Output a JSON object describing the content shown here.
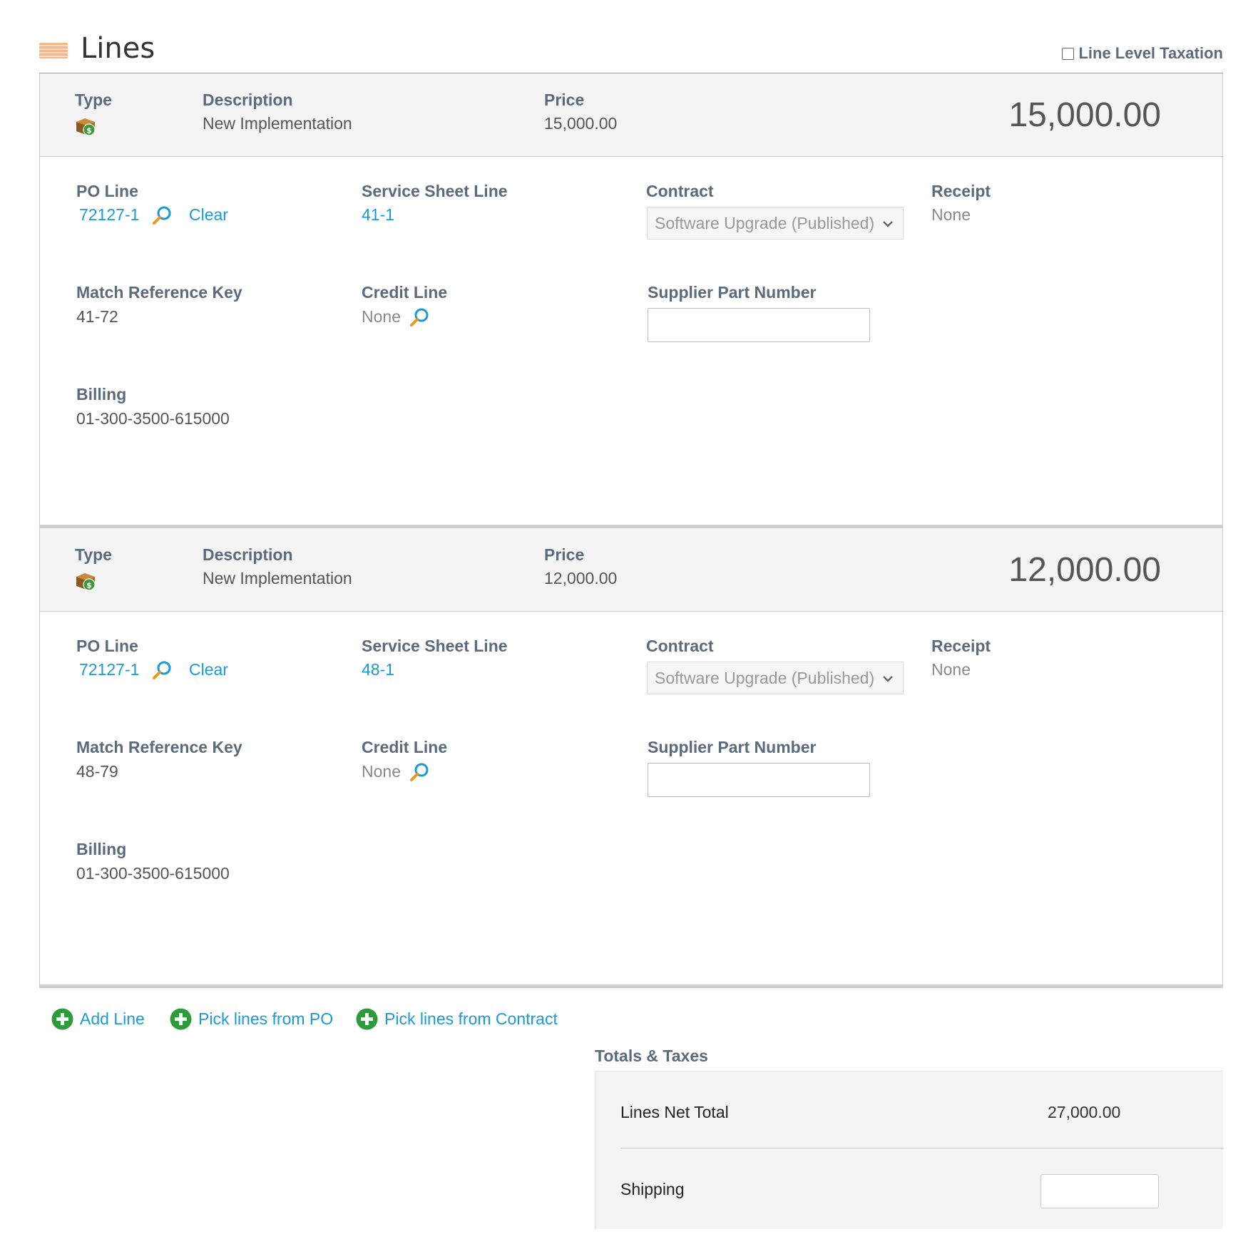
{
  "section": {
    "title": "Lines",
    "line_level_taxation_label": "Line Level Taxation",
    "line_level_taxation_checked": false
  },
  "labels": {
    "type": "Type",
    "description": "Description",
    "price": "Price",
    "po_line": "PO Line",
    "service_sheet_line": "Service Sheet Line",
    "contract": "Contract",
    "receipt": "Receipt",
    "match_reference_key": "Match Reference Key",
    "credit_line": "Credit Line",
    "supplier_part_number": "Supplier Part Number",
    "billing": "Billing",
    "clear": "Clear"
  },
  "lines": [
    {
      "type_icon": "service-money-box-icon",
      "description": "New Implementation",
      "price": "15,000.00",
      "total": "15,000.00",
      "po_line": "72127-1",
      "service_sheet_line": "41-1",
      "contract": "Software Upgrade (Published)",
      "receipt": "None",
      "match_reference_key": "41-72",
      "credit_line": "None",
      "supplier_part_number": "",
      "billing": "01-300-3500-615000"
    },
    {
      "type_icon": "service-money-box-icon",
      "description": "New Implementation",
      "price": "12,000.00",
      "total": "12,000.00",
      "po_line": "72127-1",
      "service_sheet_line": "48-1",
      "contract": "Software Upgrade (Published)",
      "receipt": "None",
      "match_reference_key": "48-79",
      "credit_line": "None",
      "supplier_part_number": "",
      "billing": "01-300-3500-615000"
    }
  ],
  "actions": {
    "add_line": "Add Line",
    "pick_from_po": "Pick lines from PO",
    "pick_from_contract": "Pick lines from Contract"
  },
  "totals": {
    "title": "Totals & Taxes",
    "lines_net_total_label": "Lines Net Total",
    "lines_net_total_value": "27,000.00",
    "shipping_label": "Shipping",
    "shipping_value": ""
  },
  "colors": {
    "link": "#1a9ad6",
    "label": "#5a6b7d",
    "add_icon": "#2e9b3a",
    "lines_icon": "#f5b78a"
  }
}
